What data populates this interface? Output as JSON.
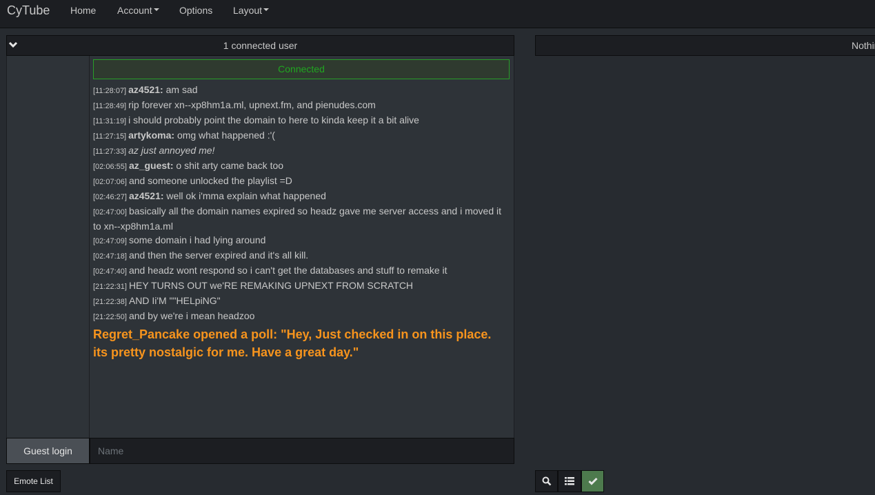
{
  "nav": {
    "brand": "CyTube",
    "items": [
      {
        "label": "Home"
      },
      {
        "label": "Account"
      },
      {
        "label": "Options"
      },
      {
        "label": "Layout"
      }
    ]
  },
  "chat": {
    "user_count": "1 connected user",
    "status": "Connected",
    "messages": [
      {
        "ts": "[11:28:07]",
        "user": "az4521:",
        "text": "am sad"
      },
      {
        "ts": "[11:28:49]",
        "user": "",
        "text": "rip forever xn--xp8hm1a.ml, upnext.fm, and pienudes.com"
      },
      {
        "ts": "[11:31:19]",
        "user": "",
        "text": "i should probably point the domain to here to kinda keep it a bit alive"
      },
      {
        "ts": "[11:27:15]",
        "user": "artykoma:",
        "text": "omg what happened :'("
      },
      {
        "ts": "[11:27:33]",
        "user": "",
        "text": "az just annoyed me!",
        "italic": true
      },
      {
        "ts": "[02:06:55]",
        "user": "az_guest:",
        "text": "o shit arty came back too"
      },
      {
        "ts": "[02:07:06]",
        "user": "",
        "text": "and someone unlocked the playlist =D"
      },
      {
        "ts": "[02:46:27]",
        "user": "az4521:",
        "text": "well ok i'mma explain what happened"
      },
      {
        "ts": "[02:47:00]",
        "user": "",
        "text": "basically all the domain names expired so headz gave me server access and i moved it to xn--xp8hm1a.ml"
      },
      {
        "ts": "[02:47:09]",
        "user": "",
        "text": "some domain i had lying around"
      },
      {
        "ts": "[02:47:18]",
        "user": "",
        "text": "and then the server expired and it's all kill."
      },
      {
        "ts": "[02:47:40]",
        "user": "",
        "text": "and headz wont respond so i can't get the databases and stuff to remake it"
      },
      {
        "ts": "[21:22:31]",
        "user": "",
        "text": "HEY TURNS OUT we'RE REMAKING UPNEXT FROM SCRATCH"
      },
      {
        "ts": "[21:22:38]",
        "user": "",
        "text": "AND Ii'M \"\"HELpiNG\""
      },
      {
        "ts": "[21:22:50]",
        "user": "",
        "text": "and by we're i mean headzoo"
      }
    ],
    "poll": "Regret_Pancake opened a poll: \"Hey, Just checked in on this place. its pretty nostalgic for me. Have a great day.\""
  },
  "guest": {
    "button": "Guest login",
    "placeholder": "Name"
  },
  "emote_button": "Emote List",
  "video": {
    "header": "Nothing Playing"
  },
  "icons": {
    "chevron": "chevron-down-icon",
    "search": "search-icon",
    "list": "list-icon",
    "check": "check-icon"
  },
  "colors": {
    "poll": "#f7941d",
    "connected": "#20a620",
    "check_button": "#4d7a4d"
  }
}
